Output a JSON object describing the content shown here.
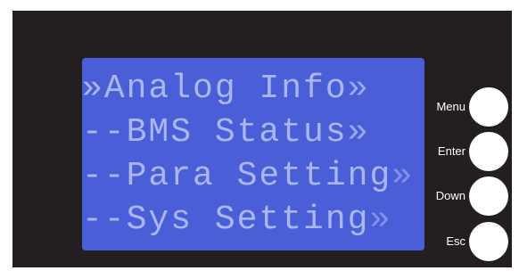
{
  "display": {
    "rows": [
      {
        "prefix": "»",
        "label": "Analog Info",
        "suffix": "»"
      },
      {
        "prefix": "--",
        "label": "BMS Status",
        "suffix": "»"
      },
      {
        "prefix": "--",
        "label": "Para Setting",
        "suffix": "»"
      },
      {
        "prefix": "--",
        "label": "Sys Setting",
        "suffix": "»"
      }
    ]
  },
  "keys": {
    "menu": "Menu",
    "enter": "Enter",
    "down": "Down",
    "esc": "Esc"
  },
  "colors": {
    "panel": "#231f20",
    "screen": "#4a5ed8",
    "text": "#a9b6f0",
    "button": "#ffffff"
  }
}
